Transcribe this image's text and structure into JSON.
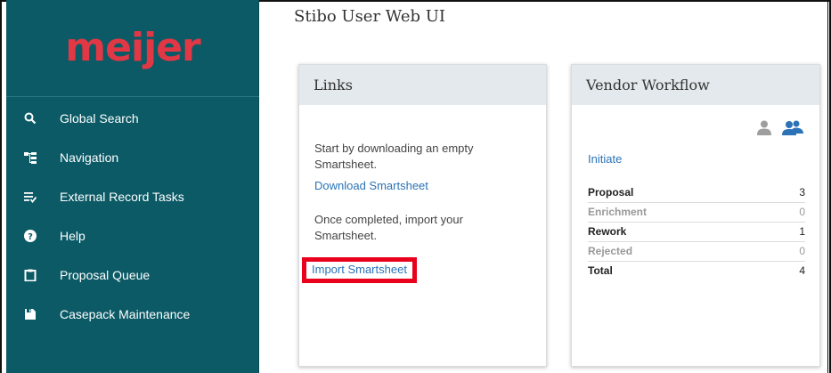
{
  "app": {
    "title": "Stibo User Web UI",
    "logo_text": "meijer"
  },
  "colors": {
    "sidebar_bg": "#0b5a66",
    "logo": "#e23744",
    "link": "#2b73b7",
    "highlight_box": "#e8001c"
  },
  "sidebar": {
    "items": [
      {
        "label": "Global Search",
        "icon": "search-icon"
      },
      {
        "label": "Navigation",
        "icon": "navigation-tree-icon"
      },
      {
        "label": "External Record Tasks",
        "icon": "task-list-icon"
      },
      {
        "label": "Help",
        "icon": "help-icon"
      },
      {
        "label": "Proposal Queue",
        "icon": "clipboard-icon"
      },
      {
        "label": "Casepack Maintenance",
        "icon": "save-icon"
      }
    ]
  },
  "links_card": {
    "title": "Links",
    "intro_text": "Start by downloading an empty Smartsheet.",
    "download_link": "Download Smartsheet",
    "completed_text": "Once completed, import your Smartsheet.",
    "import_link": "Import Smartsheet"
  },
  "vendor_card": {
    "title": "Vendor Workflow",
    "icons": [
      "user-icon",
      "users-icon"
    ],
    "initiate_link": "Initiate",
    "rows": [
      {
        "label": "Proposal",
        "value": "3"
      },
      {
        "label": "Enrichment",
        "value": "0"
      },
      {
        "label": "Rework",
        "value": "1"
      },
      {
        "label": "Rejected",
        "value": "0"
      },
      {
        "label": "Total",
        "value": "4"
      }
    ]
  }
}
